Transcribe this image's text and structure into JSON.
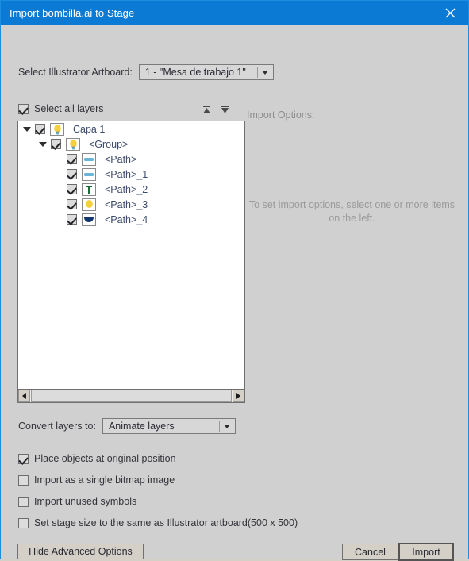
{
  "titlebar": {
    "title": "Import bombilla.ai to Stage",
    "close_icon": "close-icon"
  },
  "artboard": {
    "label": "Select Illustrator Artboard:",
    "selected": "1 - \"Mesa de trabajo 1\"",
    "options": [
      "1 - \"Mesa de trabajo 1\""
    ]
  },
  "select_all": {
    "label": "Select all layers",
    "checked": true
  },
  "sort": {
    "up_icon": "sort-ascending-icon",
    "down_icon": "sort-descending-icon"
  },
  "import_options": {
    "title": "Import Options:",
    "hint": "To set import options, select one or more items on the left."
  },
  "tree": {
    "rows": [
      {
        "label": "Capa 1",
        "checked": true,
        "depth": 0,
        "expander": true,
        "thumb": "bulb-icon"
      },
      {
        "label": "<Group>",
        "checked": true,
        "depth": 1,
        "expander": true,
        "thumb": "bulb-icon"
      },
      {
        "label": "<Path>",
        "checked": true,
        "depth": 2,
        "expander": false,
        "thumb": "blue-bar-icon"
      },
      {
        "label": "<Path>_1",
        "checked": true,
        "depth": 2,
        "expander": false,
        "thumb": "blue-bar-icon"
      },
      {
        "label": "<Path>_2",
        "checked": true,
        "depth": 2,
        "expander": false,
        "thumb": "green-stem-icon"
      },
      {
        "label": "<Path>_3",
        "checked": true,
        "depth": 2,
        "expander": false,
        "thumb": "yellow-bulb-icon"
      },
      {
        "label": "<Path>_4",
        "checked": true,
        "depth": 2,
        "expander": false,
        "thumb": "blue-bowl-icon"
      }
    ]
  },
  "scrollbar": {
    "left_icon": "scroll-left-icon",
    "right_icon": "scroll-right-icon"
  },
  "convert": {
    "label": "Convert layers to:",
    "selected": "Animate layers",
    "options": [
      "Animate layers"
    ]
  },
  "options": [
    {
      "label": "Place objects at original position",
      "checked": true
    },
    {
      "label": "Import as a single bitmap image",
      "checked": false
    },
    {
      "label": "Import unused symbols",
      "checked": false
    },
    {
      "label": "Set stage size to the same as Illustrator artboard(500 x 500)",
      "checked": false
    }
  ],
  "buttons": {
    "hide_advanced": "Hide Advanced Options",
    "cancel": "Cancel",
    "import": "Import"
  },
  "colors": {
    "title_bar": "#0b7ad4",
    "dialog_bg": "#d0d0d0",
    "tree_text": "#3c4a6b",
    "muted_text": "#9a9a9a"
  }
}
